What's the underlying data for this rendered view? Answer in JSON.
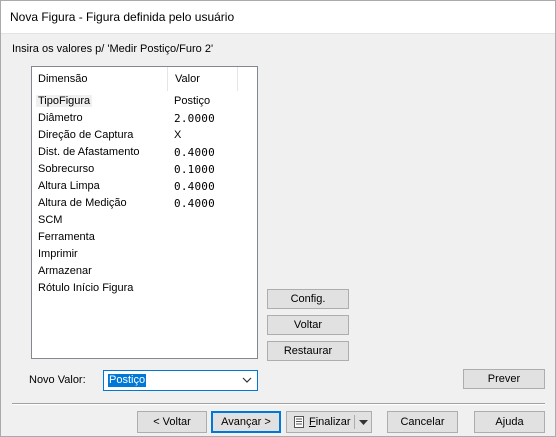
{
  "window": {
    "title": "Nova Figura - Figura definida pelo usuário"
  },
  "prompt": "Insira os valores p/ 'Medir Postiço/Furo 2'",
  "table": {
    "columns": [
      "Dimensão",
      "Valor"
    ],
    "rows": [
      {
        "dimension": "TipoFigura",
        "value": "Postiço"
      },
      {
        "dimension": "Diâmetro",
        "value": "2.0000"
      },
      {
        "dimension": "Direção de Captura",
        "value": "X"
      },
      {
        "dimension": "Dist. de Afastamento",
        "value": "0.4000"
      },
      {
        "dimension": "Sobrecurso",
        "value": "0.1000"
      },
      {
        "dimension": "Altura Limpa",
        "value": "0.4000"
      },
      {
        "dimension": "Altura de Medição",
        "value": "0.4000"
      },
      {
        "dimension": "SCM",
        "value": ""
      },
      {
        "dimension": "Ferramenta",
        "value": ""
      },
      {
        "dimension": "Imprimir",
        "value": ""
      },
      {
        "dimension": "Armazenar",
        "value": ""
      },
      {
        "dimension": "Rótulo Início Figura",
        "value": ""
      }
    ]
  },
  "side_buttons": {
    "config": "Config.",
    "voltar": "Voltar",
    "restaurar": "Restaurar",
    "prever": "Prever"
  },
  "novo_valor": {
    "label": "Novo Valor:",
    "value": "Postiço"
  },
  "footer": {
    "voltar": "< Voltar",
    "avancar": "Avançar >",
    "finalizar_prefix": "",
    "finalizar_underlined": "F",
    "finalizar_rest": "inalizar",
    "cancelar": "Cancelar",
    "ajuda": "Ajuda"
  },
  "colors": {
    "accent": "#0078d7",
    "dialog_bg": "#f0f0f0"
  }
}
